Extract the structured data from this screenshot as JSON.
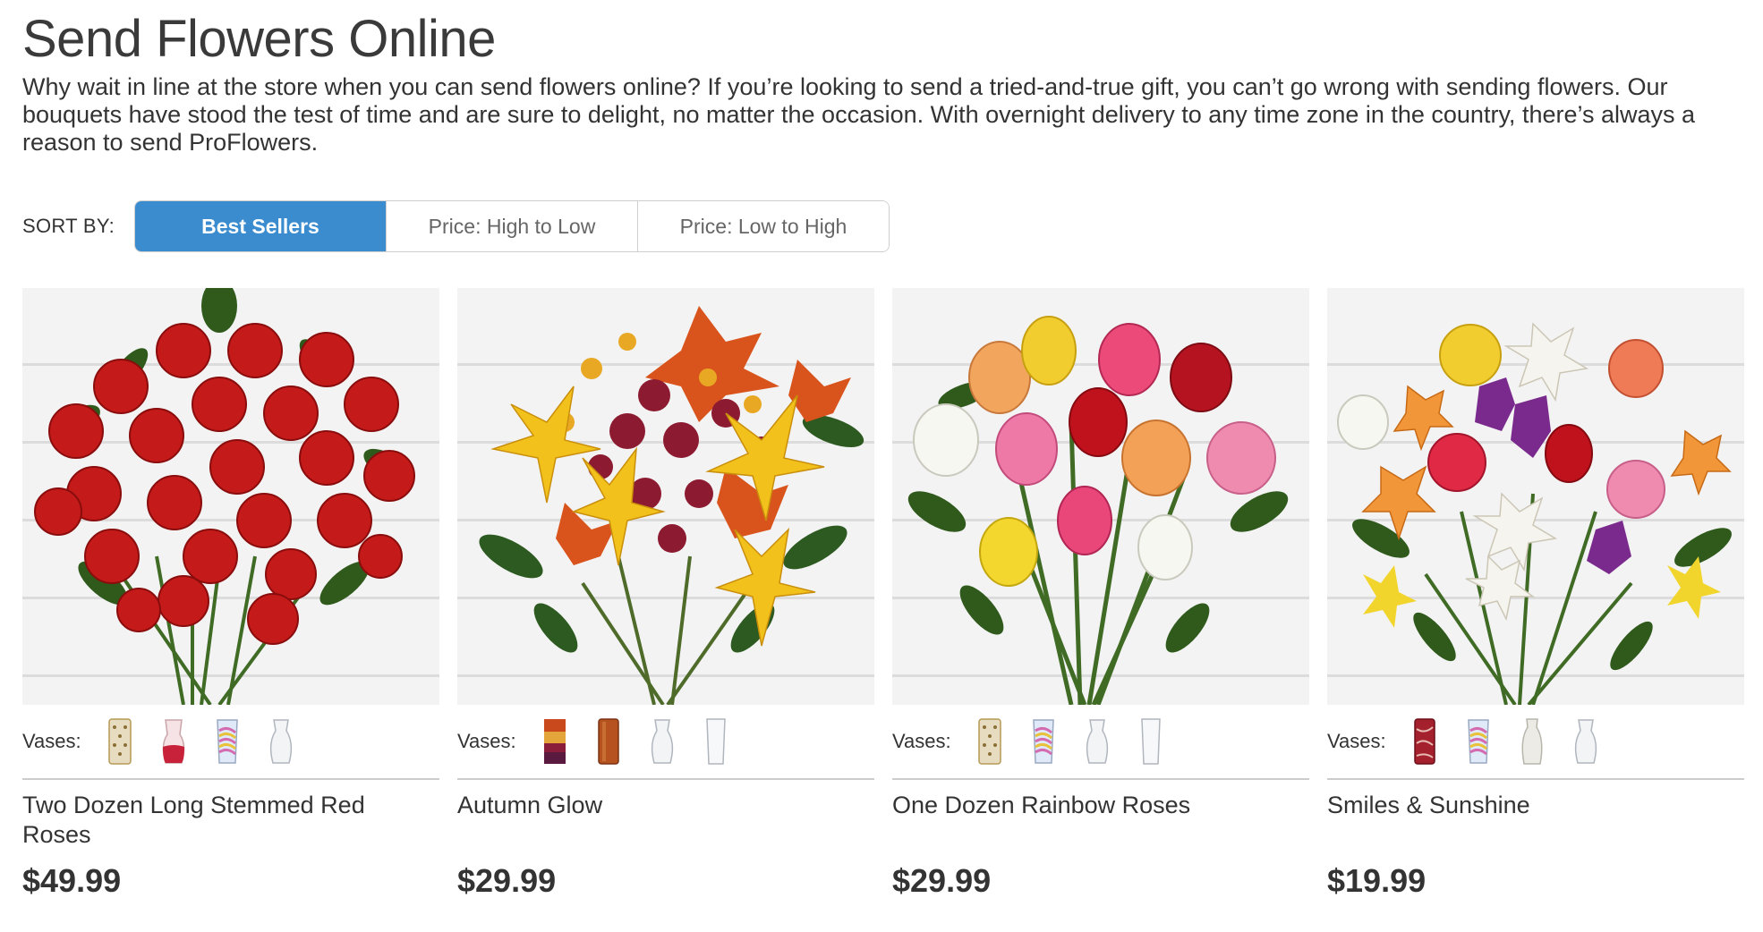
{
  "page": {
    "title": "Send Flowers Online",
    "intro": "Why wait in line at the store when you can send flowers online? If you’re looking to send a tried-and-true gift, you can’t go wrong with sending flowers. Our bouquets have stood the test of time and are sure to delight, no matter the occasion. With overnight delivery to any time zone in the country, there’s always a reason to send ProFlowers."
  },
  "sort": {
    "label": "SORT BY:",
    "options": [
      "Best Sellers",
      "Price: High to Low",
      "Price: Low to High"
    ],
    "selected": "Best Sellers",
    "active_color": "#3a8ccf"
  },
  "products": [
    {
      "name": "Two Dozen Long Stemmed Red Roses",
      "price": "$49.99",
      "vases_label": "Vases:",
      "vases": [
        "gold-lattice-vase",
        "red-ombre-vase",
        "rainbow-vase",
        "clear-glass-vase"
      ]
    },
    {
      "name": "Autumn Glow",
      "price": "$29.99",
      "vases_label": "Vases:",
      "vases": [
        "sunset-stripe-vase",
        "amber-cylinder-vase",
        "clear-glass-vase",
        "clear-cylinder-vase"
      ]
    },
    {
      "name": "One Dozen Rainbow Roses",
      "price": "$29.99",
      "vases_label": "Vases:",
      "vases": [
        "gold-lattice-vase",
        "rainbow-vase",
        "clear-glass-vase",
        "clear-cylinder-vase"
      ]
    },
    {
      "name": "Smiles & Sunshine",
      "price": "$19.99",
      "vases_label": "Vases:",
      "vases": [
        "red-marble-vase",
        "rainbow-vase",
        "white-ceramic-vase",
        "clear-glass-vase"
      ]
    }
  ]
}
